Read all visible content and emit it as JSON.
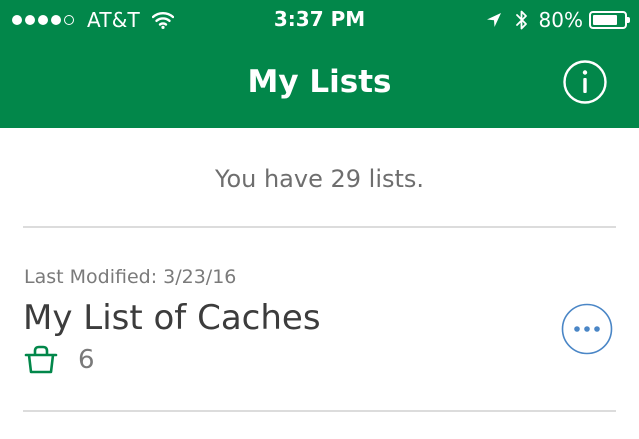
{
  "status_bar": {
    "carrier": "AT&T",
    "time": "3:37 PM",
    "battery_percent": "80%",
    "battery_level": 0.8,
    "signal_bars_filled": 4,
    "signal_bars_total": 5
  },
  "nav": {
    "title": "My Lists",
    "info_icon": "info-circle-icon"
  },
  "summary": "You have 29 lists.",
  "lists": [
    {
      "last_modified": "Last Modified: 3/23/16",
      "name": "My List of Caches",
      "count": "6",
      "count_icon": "basket-icon",
      "more_icon": "ellipsis-circle-icon"
    }
  ],
  "colors": {
    "brand_green": "#02874a",
    "accent_blue": "#4a86c6",
    "text_gray": "#6e6e6e"
  }
}
